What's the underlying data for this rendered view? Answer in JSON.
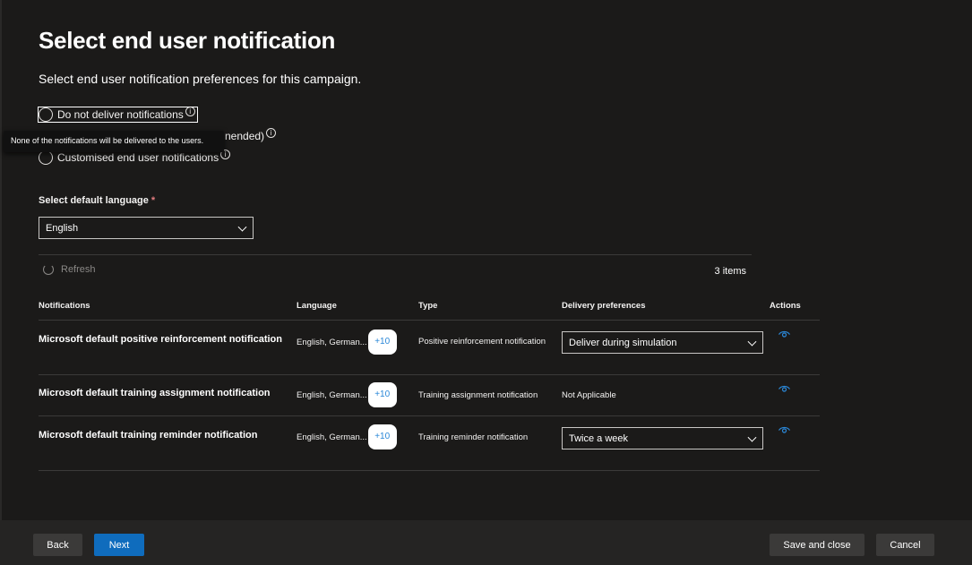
{
  "page": {
    "title": "Select end user notification",
    "subtitle": "Select end user notification preferences for this campaign."
  },
  "options": {
    "do_not_deliver": "Do not deliver notifications",
    "hidden_suffix": "nended)",
    "customised": "Customised end user notifications",
    "info_glyph": "i"
  },
  "tooltip": {
    "text": "None of the notifications will be delivered to the users."
  },
  "language": {
    "label": "Select default language",
    "required_mark": "*",
    "value": "English"
  },
  "toolbar": {
    "refresh_label": "Refresh",
    "items_count": "3 items"
  },
  "table": {
    "headers": {
      "notifications": "Notifications",
      "language": "Language",
      "type": "Type",
      "delivery": "Delivery preferences",
      "actions": "Actions"
    },
    "rows": [
      {
        "name": "Microsoft default positive reinforcement notification",
        "language": "English, German...",
        "more_languages": "+10",
        "type": "Positive reinforcement notification",
        "delivery": "Deliver during simulation",
        "delivery_kind": "dropdown"
      },
      {
        "name": "Microsoft default training assignment notification",
        "language": "English, German...",
        "more_languages": "+10",
        "type": "Training assignment notification",
        "delivery": "Not Applicable",
        "delivery_kind": "text"
      },
      {
        "name": "Microsoft default training reminder notification",
        "language": "English, German...",
        "more_languages": "+10",
        "type": "Training reminder notification",
        "delivery": "Twice a week",
        "delivery_kind": "dropdown"
      }
    ]
  },
  "footer": {
    "back": "Back",
    "next": "Next",
    "save_close": "Save and close",
    "cancel": "Cancel"
  },
  "colors": {
    "background": "#1b1a19",
    "accent": "#0f6cbd",
    "link": "#2b88d8",
    "footer": "#252423"
  }
}
